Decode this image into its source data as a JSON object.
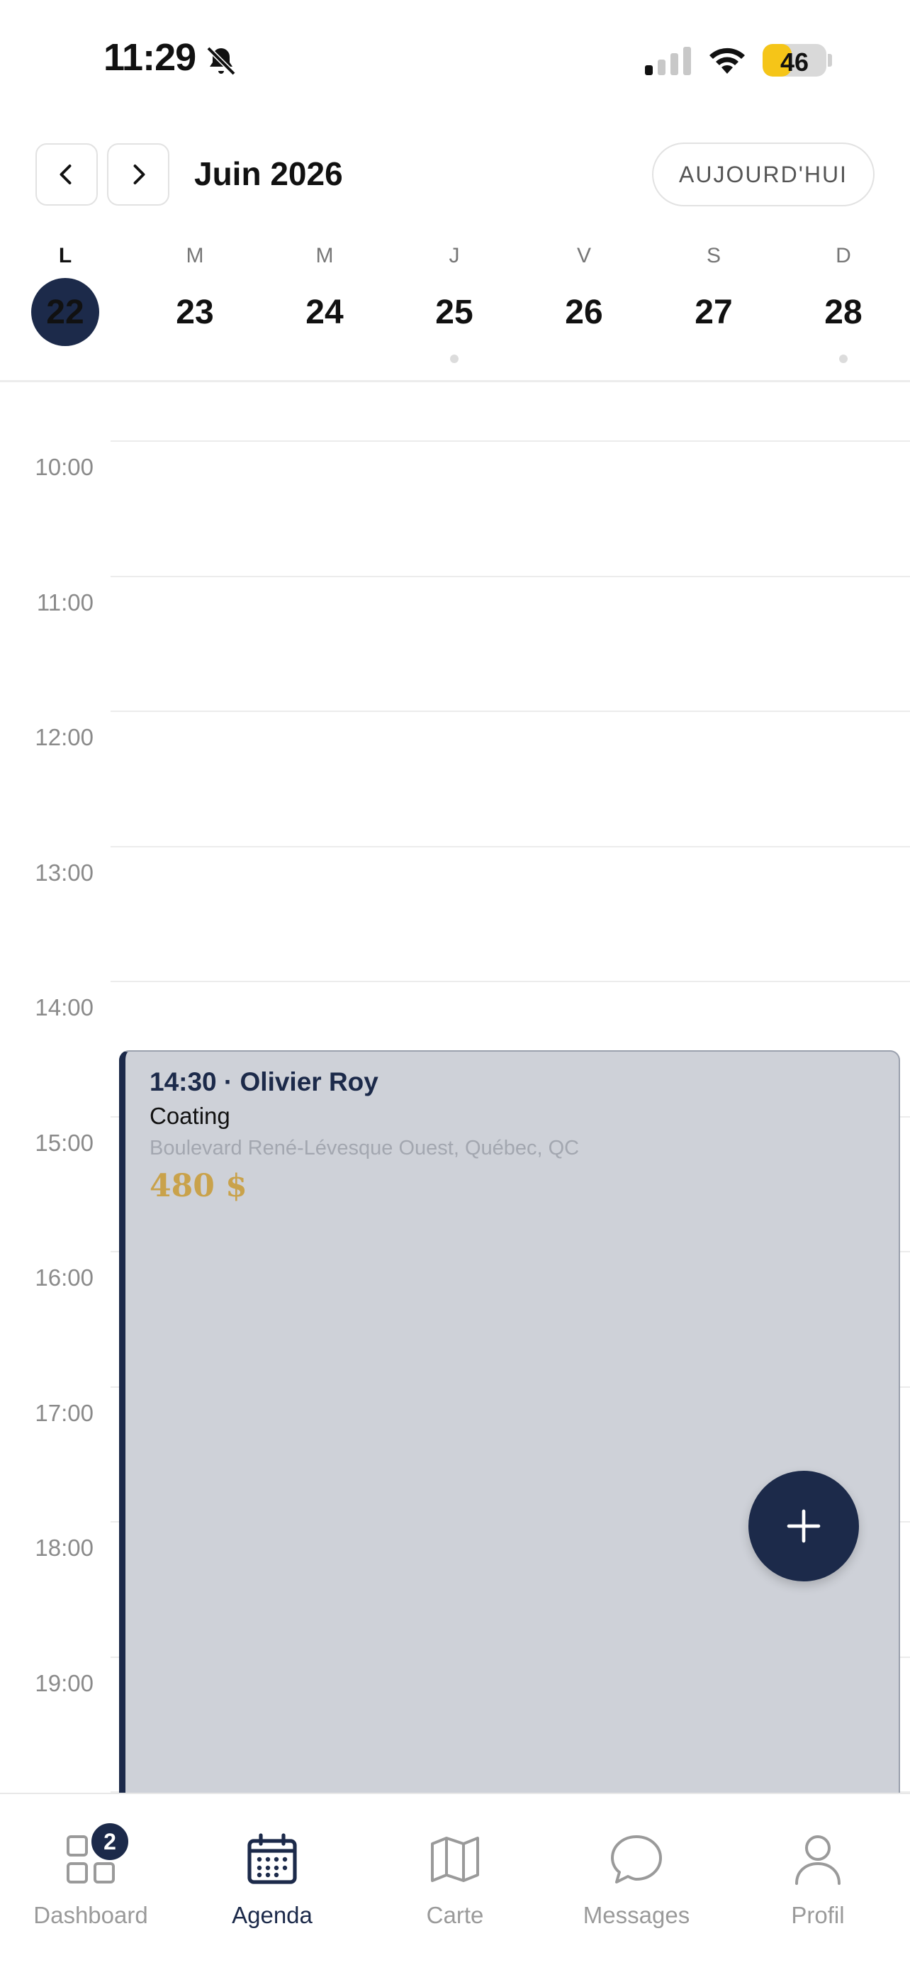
{
  "status_bar": {
    "time": "11:29",
    "battery_level": "46",
    "battery_color": "#f5c518",
    "icons": [
      "bell-slash-icon",
      "signal-icon",
      "wifi-icon",
      "battery-icon"
    ]
  },
  "header": {
    "prev_icon": "chevron-left-icon",
    "next_icon": "chevron-right-icon",
    "month_title": "Juin 2026",
    "today_label": "AUJOURD'HUI"
  },
  "week": {
    "days": [
      {
        "letter": "L",
        "number": "22",
        "active": true,
        "has_event": false
      },
      {
        "letter": "M",
        "number": "23",
        "active": false,
        "has_event": false
      },
      {
        "letter": "M",
        "number": "24",
        "active": false,
        "has_event": false
      },
      {
        "letter": "J",
        "number": "25",
        "active": false,
        "has_event": true
      },
      {
        "letter": "V",
        "number": "26",
        "active": false,
        "has_event": false
      },
      {
        "letter": "S",
        "number": "27",
        "active": false,
        "has_event": false
      },
      {
        "letter": "D",
        "number": "28",
        "active": false,
        "has_event": true
      }
    ]
  },
  "timeline": {
    "hours": [
      "10:00",
      "11:00",
      "12:00",
      "13:00",
      "14:00",
      "15:00",
      "16:00",
      "17:00",
      "18:00",
      "19:00"
    ]
  },
  "event": {
    "title": "14:30 · Olivier Roy",
    "service": "Coating",
    "address": "Boulevard René-Lévesque Ouest, Québec, QC",
    "price": "480 $",
    "accent_color": "#1c2a4a",
    "price_color": "#c9a24b"
  },
  "fab": {
    "icon": "plus-icon"
  },
  "tabbar": {
    "tabs": [
      {
        "label": "Dashboard",
        "icon": "dashboard-grid-icon",
        "badge": "2",
        "active": false
      },
      {
        "label": "Agenda",
        "icon": "calendar-icon",
        "active": true
      },
      {
        "label": "Carte",
        "icon": "map-icon",
        "active": false
      },
      {
        "label": "Messages",
        "icon": "chat-bubble-icon",
        "active": false
      },
      {
        "label": "Profil",
        "icon": "user-icon",
        "active": false
      }
    ]
  },
  "colors": {
    "primary": "#1c2a4a",
    "event_bg": "#ced1d8",
    "muted_text": "#9a9a9a"
  }
}
